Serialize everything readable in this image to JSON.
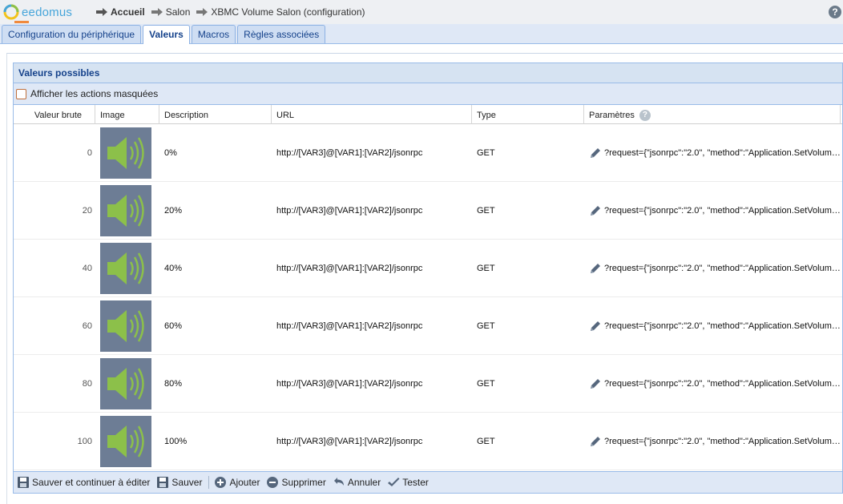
{
  "header": {
    "logo_text": "eedomus",
    "breadcrumbs": [
      "Accueil",
      "Salon",
      "XBMC Volume Salon (configuration)"
    ],
    "help_label": "?"
  },
  "tabs": [
    {
      "label": "Configuration du périphérique",
      "active": false
    },
    {
      "label": "Valeurs",
      "active": true
    },
    {
      "label": "Macros",
      "active": false
    },
    {
      "label": "Règles associées",
      "active": false
    }
  ],
  "panel": {
    "title": "Valeurs possibles",
    "show_hidden_label": "Afficher les actions masquées",
    "show_hidden_checked": false
  },
  "table": {
    "columns": [
      "Valeur brute",
      "Image",
      "Description",
      "URL",
      "Type",
      "Paramètres"
    ],
    "rows": [
      {
        "raw": "0",
        "description": "0%",
        "url": "http://[VAR3]@[VAR1]:[VAR2]/jsonrpc",
        "type": "GET",
        "params": "?request={\"jsonrpc\":\"2.0\", \"method\":\"Application.SetVolum…"
      },
      {
        "raw": "20",
        "description": "20%",
        "url": "http://[VAR3]@[VAR1]:[VAR2]/jsonrpc",
        "type": "GET",
        "params": "?request={\"jsonrpc\":\"2.0\", \"method\":\"Application.SetVolum…"
      },
      {
        "raw": "40",
        "description": "40%",
        "url": "http://[VAR3]@[VAR1]:[VAR2]/jsonrpc",
        "type": "GET",
        "params": "?request={\"jsonrpc\":\"2.0\", \"method\":\"Application.SetVolum…"
      },
      {
        "raw": "60",
        "description": "60%",
        "url": "http://[VAR3]@[VAR1]:[VAR2]/jsonrpc",
        "type": "GET",
        "params": "?request={\"jsonrpc\":\"2.0\", \"method\":\"Application.SetVolum…"
      },
      {
        "raw": "80",
        "description": "80%",
        "url": "http://[VAR3]@[VAR1]:[VAR2]/jsonrpc",
        "type": "GET",
        "params": "?request={\"jsonrpc\":\"2.0\", \"method\":\"Application.SetVolum…"
      },
      {
        "raw": "100",
        "description": "100%",
        "url": "http://[VAR3]@[VAR1]:[VAR2]/jsonrpc",
        "type": "GET",
        "params": "?request={\"jsonrpc\":\"2.0\", \"method\":\"Application.SetVolum…"
      }
    ],
    "row_image_icon": "speaker-volume-icon",
    "edit_icon": "pencil-icon"
  },
  "toolbar": {
    "save_continue": "Sauver et continuer à éditer",
    "save": "Sauver",
    "add": "Ajouter",
    "delete": "Supprimer",
    "cancel": "Annuler",
    "test": "Tester"
  },
  "colors": {
    "accent": "#15428b",
    "tab_bg": "#dfe8f6",
    "border": "#99bbe8",
    "speaker": "#8cc04a",
    "thumb_bg": "#6d7d95"
  }
}
